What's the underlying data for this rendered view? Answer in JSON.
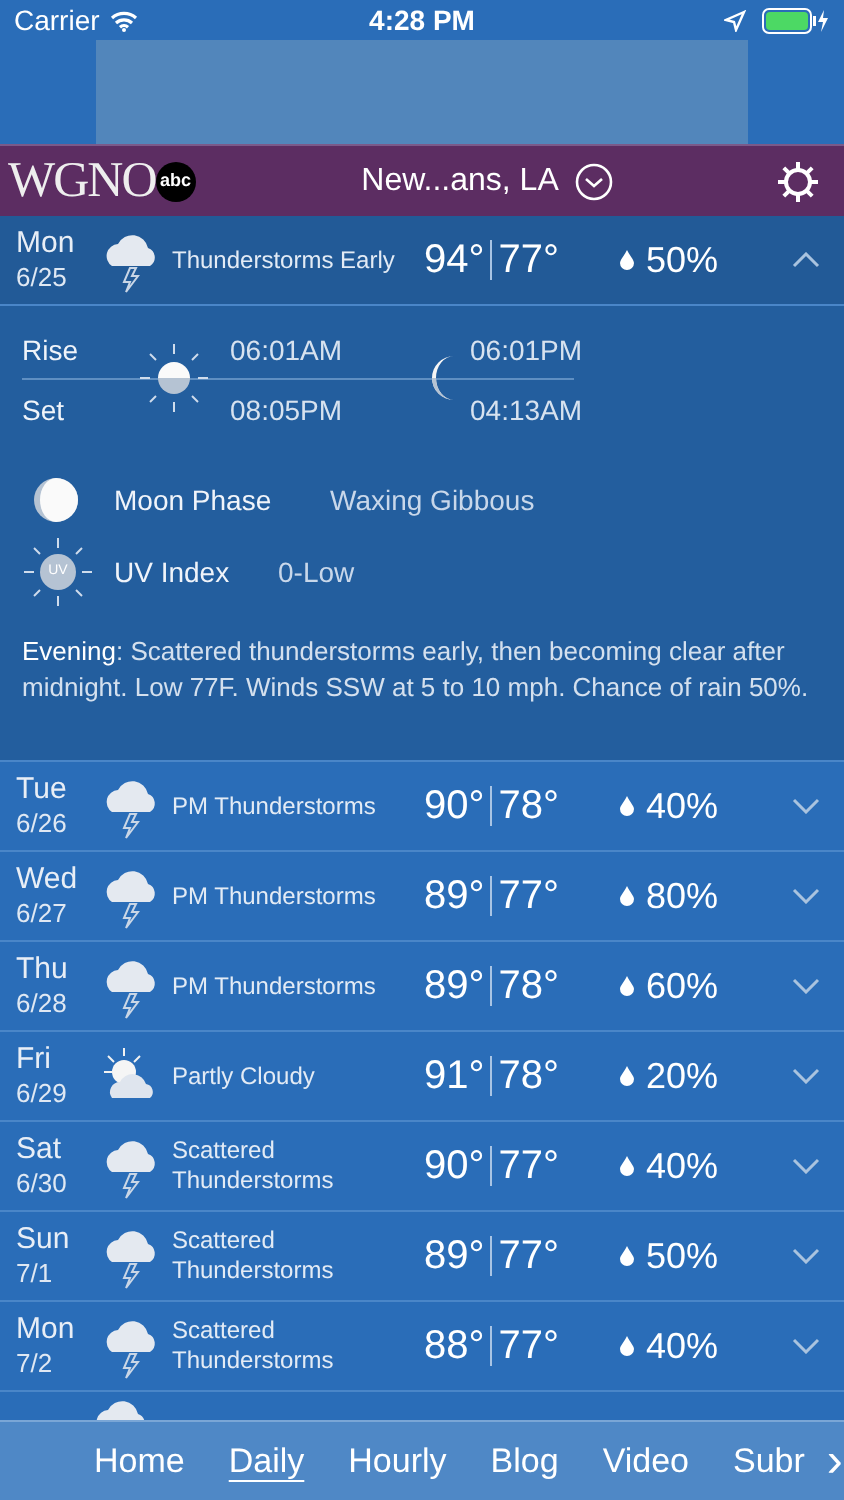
{
  "status_bar": {
    "carrier": "Carrier",
    "time": "4:28 PM"
  },
  "header": {
    "logo": "WGNO",
    "network": "abc",
    "location": "New...ans, LA"
  },
  "days": [
    {
      "day": "Mon",
      "date": "6/25",
      "kind": "thunderstorm",
      "condition": "Thunderstorms Early",
      "high": "94°",
      "low": "77°",
      "precip": "50%",
      "expanded": true
    },
    {
      "day": "Tue",
      "date": "6/26",
      "kind": "thunderstorm",
      "condition": "PM Thunderstorms",
      "high": "90°",
      "low": "78°",
      "precip": "40%",
      "expanded": false
    },
    {
      "day": "Wed",
      "date": "6/27",
      "kind": "thunderstorm",
      "condition": "PM Thunderstorms",
      "high": "89°",
      "low": "77°",
      "precip": "80%",
      "expanded": false
    },
    {
      "day": "Thu",
      "date": "6/28",
      "kind": "thunderstorm",
      "condition": "PM Thunderstorms",
      "high": "89°",
      "low": "78°",
      "precip": "60%",
      "expanded": false
    },
    {
      "day": "Fri",
      "date": "6/29",
      "kind": "partly-cloudy",
      "condition": "Partly Cloudy",
      "high": "91°",
      "low": "78°",
      "precip": "20%",
      "expanded": false
    },
    {
      "day": "Sat",
      "date": "6/30",
      "kind": "thunderstorm",
      "condition": "Scattered Thunderstorms",
      "high": "90°",
      "low": "77°",
      "precip": "40%",
      "expanded": false
    },
    {
      "day": "Sun",
      "date": "7/1",
      "kind": "thunderstorm",
      "condition": "Scattered Thunderstorms",
      "high": "89°",
      "low": "77°",
      "precip": "50%",
      "expanded": false
    },
    {
      "day": "Mon",
      "date": "7/2",
      "kind": "thunderstorm",
      "condition": "Scattered Thunderstorms",
      "high": "88°",
      "low": "77°",
      "precip": "40%",
      "expanded": false
    }
  ],
  "details": {
    "rise_label": "Rise",
    "set_label": "Set",
    "sunrise": "06:01AM",
    "sunset": "08:05PM",
    "moonrise": "06:01PM",
    "moonset": "04:13AM",
    "moon_phase_label": "Moon Phase",
    "moon_phase": "Waxing Gibbous",
    "uv_label": "UV Index",
    "uv_icon_text": "UV",
    "uv": "0-Low",
    "forecast": "**Evening**: Scattered thunderstorms early, then becoming clear after midnight. Low 77F. Winds SSW at 5 to 10 mph. Chance of rain 50%."
  },
  "nav": [
    {
      "label": "Home",
      "selected": false
    },
    {
      "label": "Daily",
      "selected": true
    },
    {
      "label": "Hourly",
      "selected": false
    },
    {
      "label": "Blog",
      "selected": false
    },
    {
      "label": "Video",
      "selected": false
    },
    {
      "label": "Subr",
      "selected": false
    }
  ],
  "nav_more": "›"
}
